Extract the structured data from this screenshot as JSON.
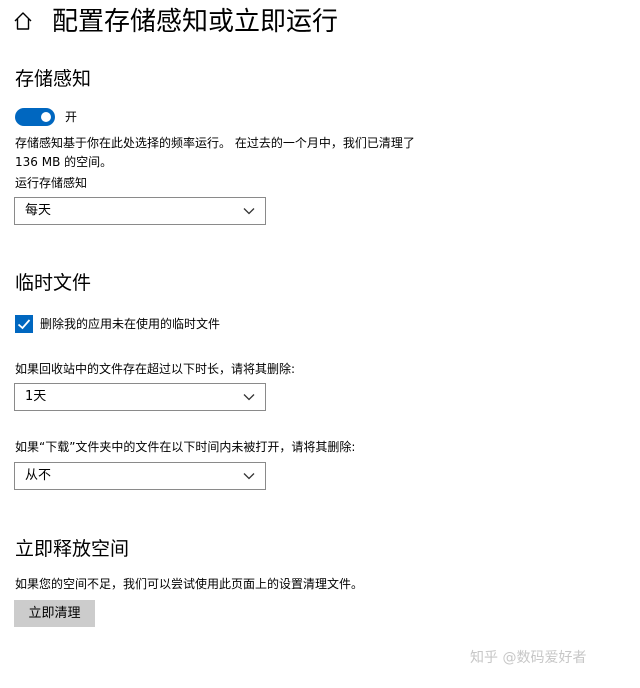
{
  "header": {
    "title": "配置存储感知或立即运行",
    "home_icon": "home-icon"
  },
  "storage_sense": {
    "title": "存储感知",
    "toggle": {
      "state": "on",
      "label": "开",
      "color": "#0067c0"
    },
    "description": "存储感知基于你在此处选择的频率运行。 在过去的一个月中，我们已清理了 136 MB 的空间。",
    "run_label": "运行存储感知",
    "run_value": "每天"
  },
  "temp_files": {
    "title": "临时文件",
    "checkbox_label": "删除我的应用未在使用的临时文件",
    "checkbox_checked": true,
    "recycle_label": "如果回收站中的文件存在超过以下时长，请将其删除:",
    "recycle_value": "1天",
    "downloads_label": "如果“下载”文件夹中的文件在以下时间内未被打开，请将其删除:",
    "downloads_value": "从不"
  },
  "free_space": {
    "title": "立即释放空间",
    "description": "如果您的空间不足，我们可以尝试使用此页面上的设置清理文件。",
    "button_label": "立即清理"
  },
  "watermark": "知乎 @数码爱好者",
  "colors": {
    "accent": "#0067c0",
    "button_bg": "#cccccc",
    "dropdown_border": "#8a8a8a"
  }
}
